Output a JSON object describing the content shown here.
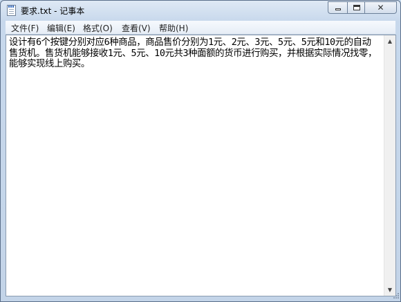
{
  "window": {
    "title": "要求.txt - 记事本",
    "icon": "notepad-icon",
    "controls": {
      "minimize": "minimize-icon",
      "maximize": "maximize-icon",
      "close_glyph": "✕"
    }
  },
  "menu": [
    {
      "label": "文件(F)"
    },
    {
      "label": "编辑(E)"
    },
    {
      "label": "格式(O)"
    },
    {
      "label": "查看(V)"
    },
    {
      "label": "帮助(H)"
    }
  ],
  "editor": {
    "content": "设计有6个按键分别对应6种商品，商品售价分别为1元、2元、3元、5元、5元和10元的自动售货机。售货机能够接收1元、5元、10元共3种面额的货币进行购买，并根据实际情况找零，能够实现线上购买。"
  },
  "scrollbar": {
    "up_glyph": "▲",
    "down_glyph": "▼"
  }
}
